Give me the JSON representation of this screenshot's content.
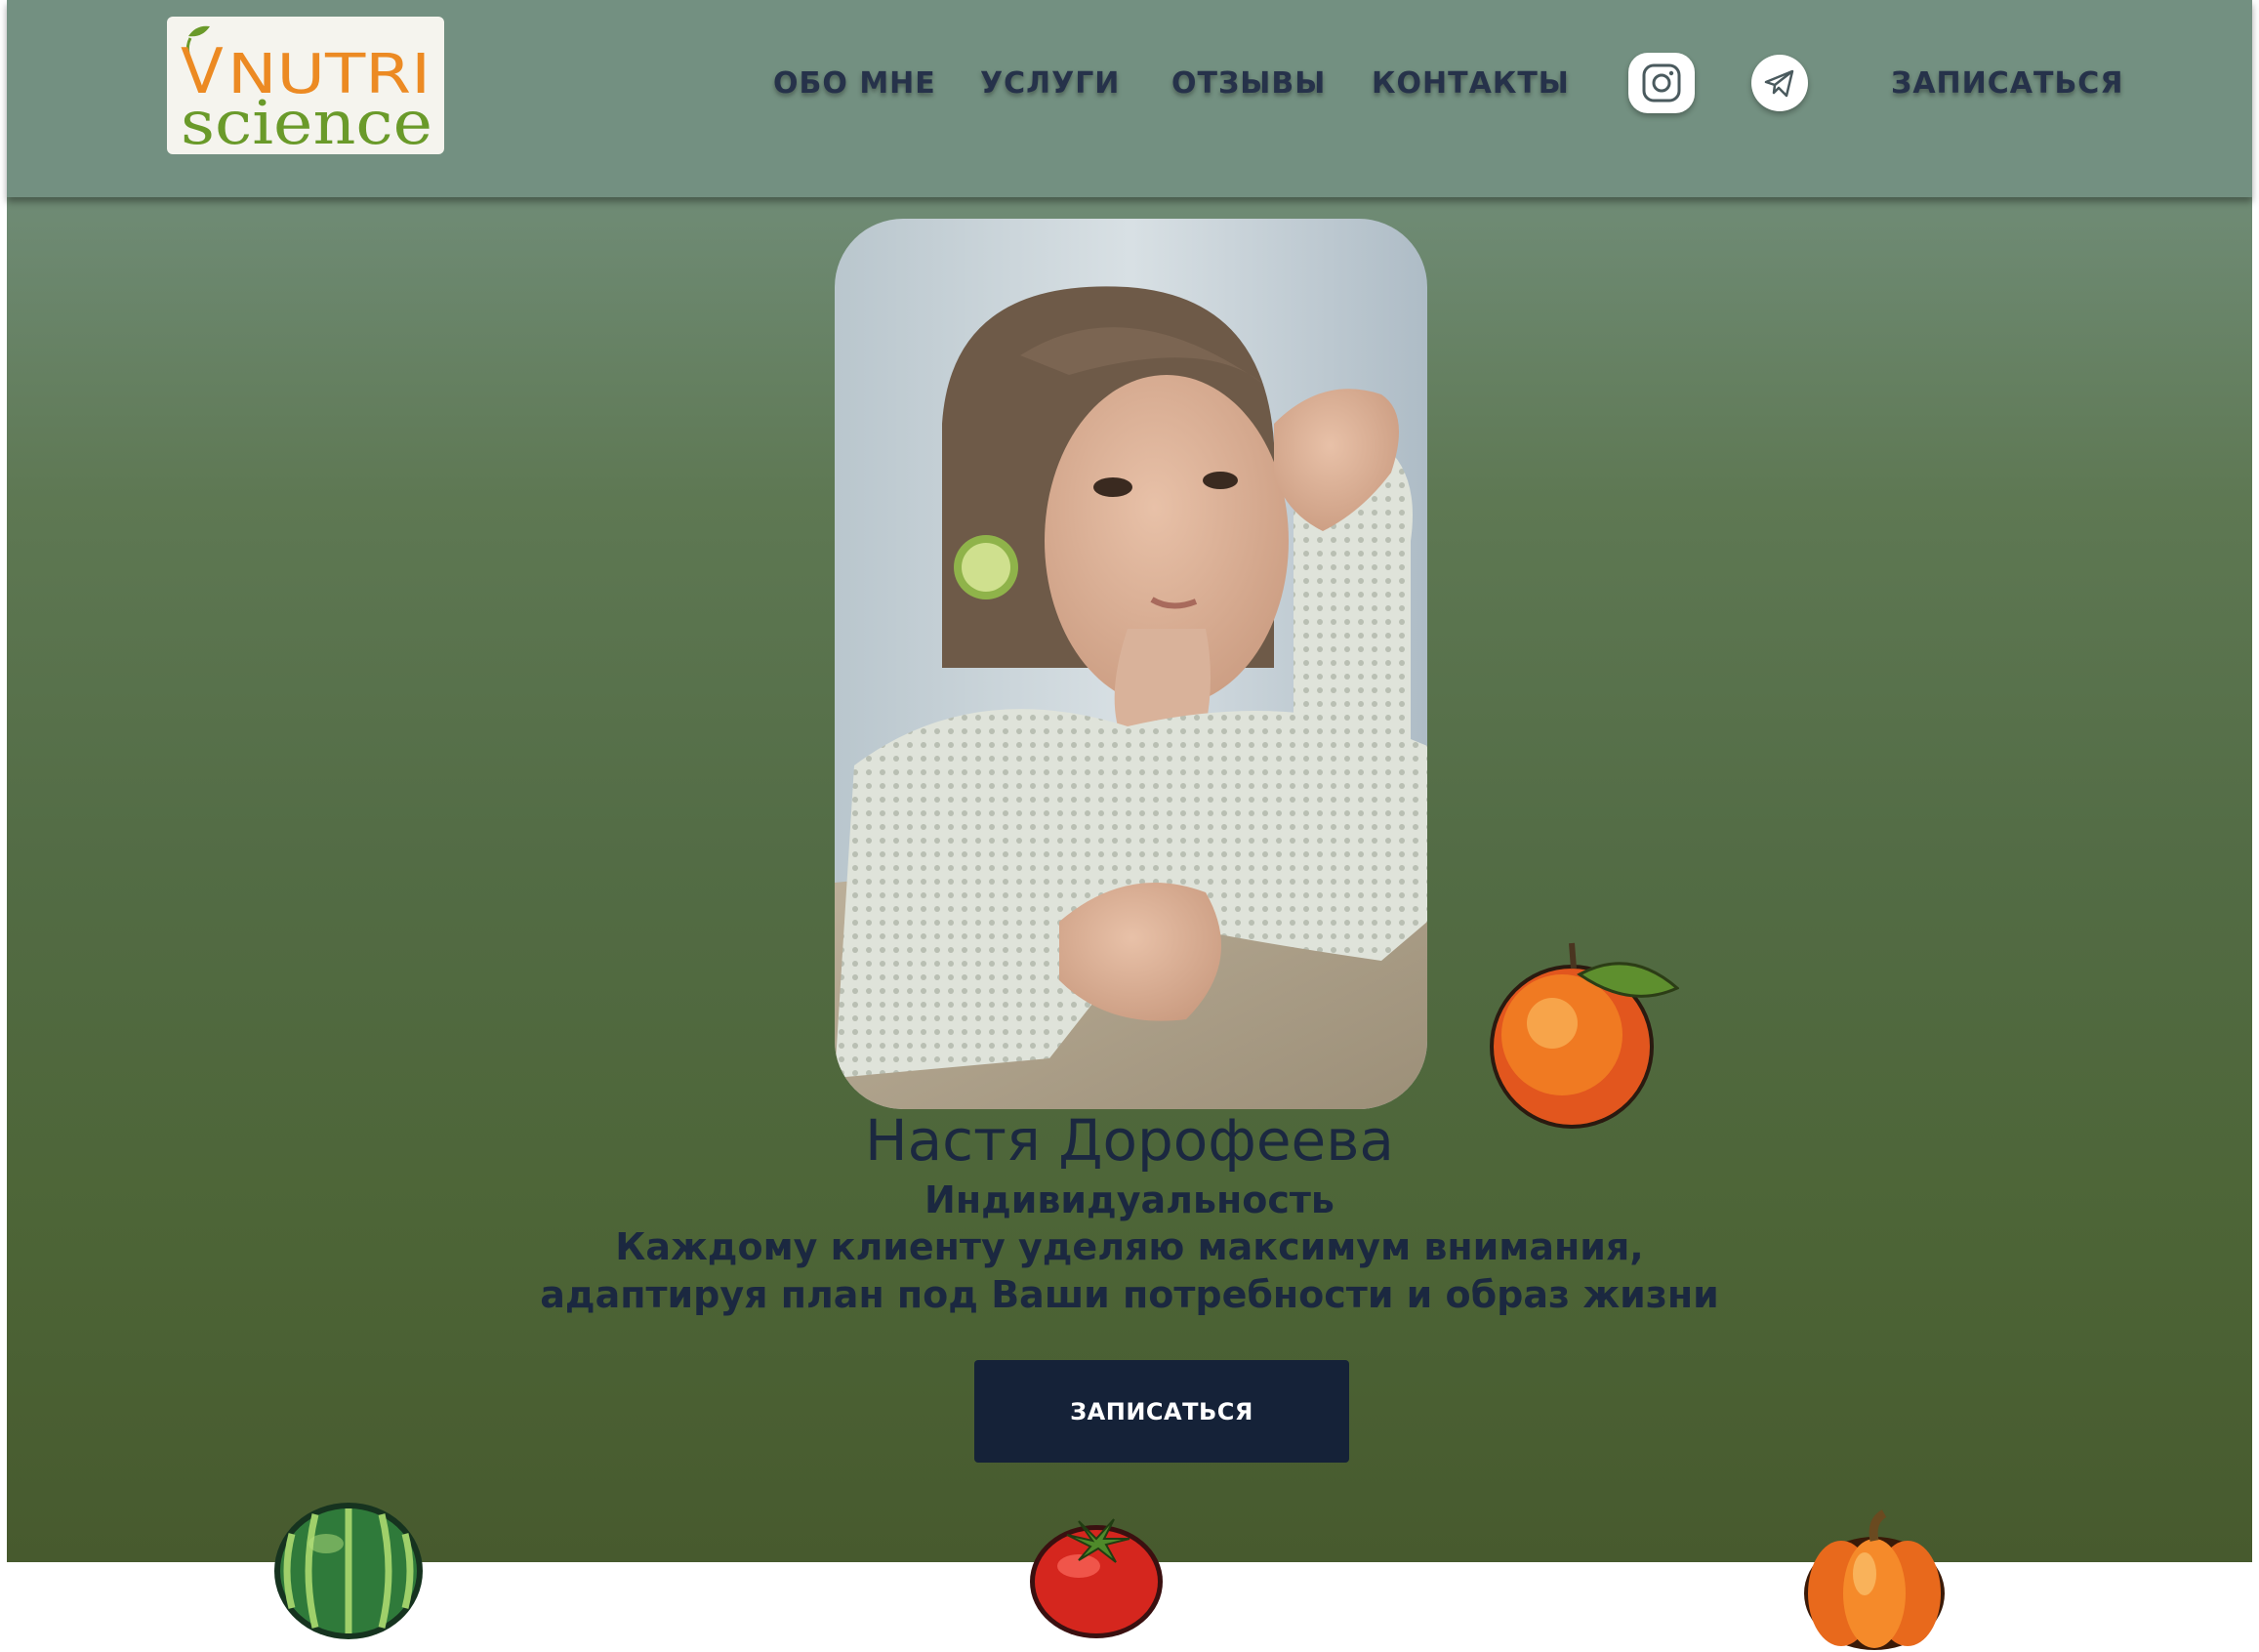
{
  "logo": {
    "line1_v": "V",
    "line1_word": "NUTRI",
    "line2": "science"
  },
  "nav": {
    "items": [
      {
        "label": "ОБО МНЕ"
      },
      {
        "label": "УСЛУГИ"
      },
      {
        "label": "ОТЗЫВЫ"
      },
      {
        "label": "КОНТАКТЫ"
      }
    ],
    "signup_label": "ЗАПИСАТЬСЯ",
    "social": [
      {
        "icon": "instagram-icon"
      },
      {
        "icon": "telegram-icon"
      }
    ]
  },
  "hero": {
    "name": "Настя Дорофеева",
    "tagline_title": "Индивидуальность",
    "tagline_line1": "Каждому клиенту уделяю максимум внимания,",
    "tagline_line2": "адаптируя план под Ваши потребности и образ жизни",
    "cta_label": "ЗАПИСАТЬСЯ"
  },
  "colors": {
    "header_bg": "#739081",
    "hero_gradient_top": "#7a9383",
    "hero_gradient_bottom": "#475a2e",
    "text_dark": "#1b2840",
    "cta_bg": "#152238",
    "logo_orange": "#ec8a23",
    "logo_green": "#6a9a2a"
  }
}
